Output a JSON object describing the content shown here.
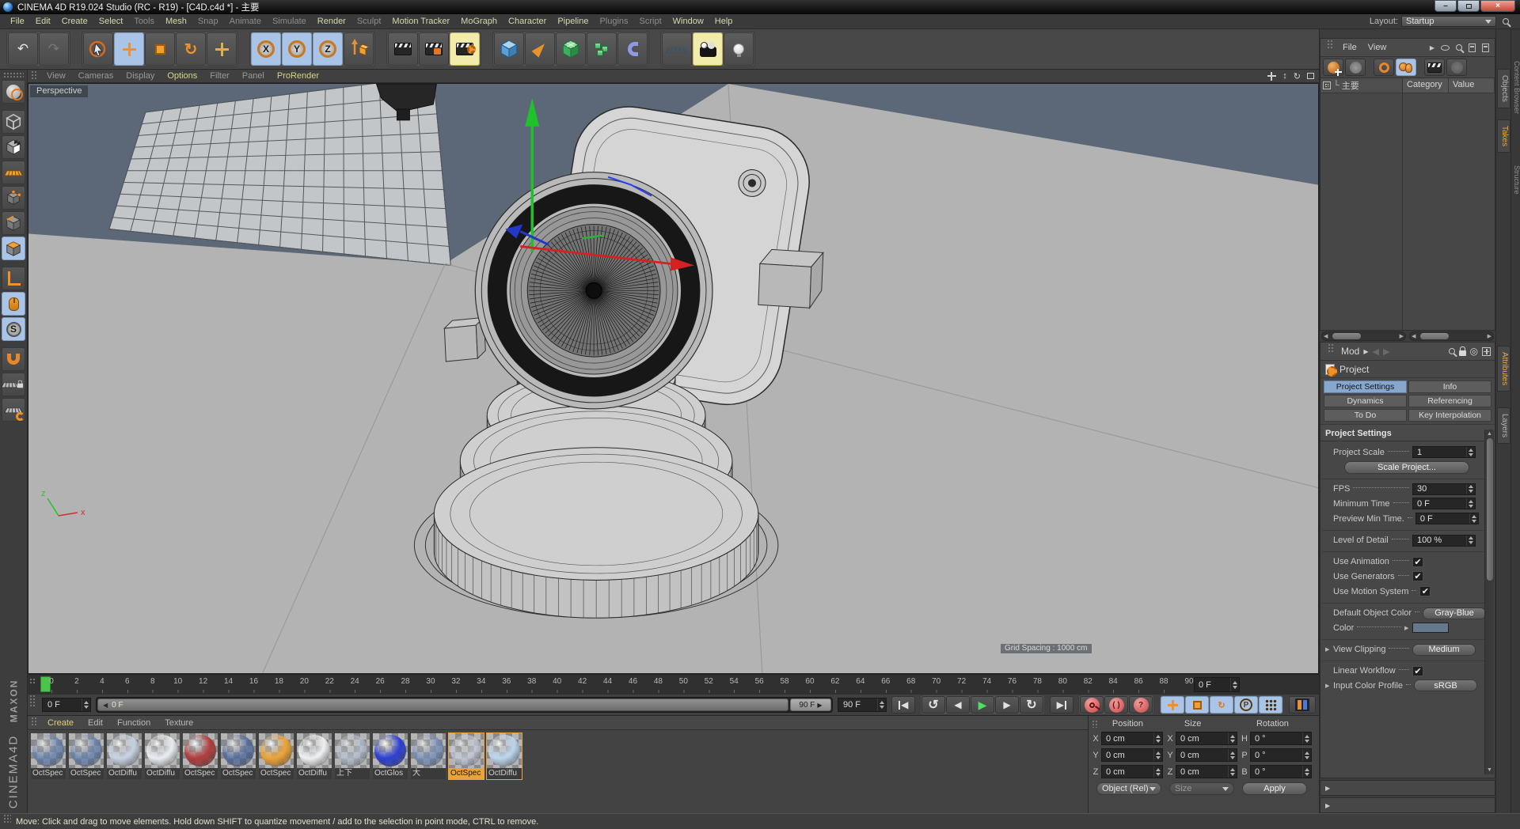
{
  "window": {
    "title": "CINEMA 4D R19.024 Studio (RC - R19) - [C4D.c4d *] - 主要"
  },
  "menu": {
    "items": [
      {
        "label": "File",
        "dim": false
      },
      {
        "label": "Edit",
        "dim": false
      },
      {
        "label": "Create",
        "dim": false
      },
      {
        "label": "Select",
        "dim": false
      },
      {
        "label": "Tools",
        "dim": true
      },
      {
        "label": "Mesh",
        "dim": false
      },
      {
        "label": "Snap",
        "dim": true
      },
      {
        "label": "Animate",
        "dim": true
      },
      {
        "label": "Simulate",
        "dim": true
      },
      {
        "label": "Render",
        "dim": false
      },
      {
        "label": "Sculpt",
        "dim": true
      },
      {
        "label": "Motion Tracker",
        "dim": false
      },
      {
        "label": "MoGraph",
        "dim": false
      },
      {
        "label": "Character",
        "dim": false
      },
      {
        "label": "Pipeline",
        "dim": false
      },
      {
        "label": "Plugins",
        "dim": true
      },
      {
        "label": "Script",
        "dim": true
      },
      {
        "label": "Window",
        "dim": false
      },
      {
        "label": "Help",
        "dim": false
      }
    ],
    "layout_label": "Layout:",
    "layout_value": "Startup"
  },
  "toolbar": {
    "axis": [
      "X",
      "Y",
      "Z"
    ]
  },
  "viewport": {
    "menu": [
      {
        "label": "View",
        "lit": false
      },
      {
        "label": "Cameras",
        "lit": false
      },
      {
        "label": "Display",
        "lit": false
      },
      {
        "label": "Options",
        "lit": true
      },
      {
        "label": "Filter",
        "lit": false
      },
      {
        "label": "Panel",
        "lit": false
      },
      {
        "label": "ProRender",
        "lit": true
      }
    ],
    "camera_label": "Perspective",
    "grid_spacing": "Grid Spacing : 1000 cm",
    "axis_z": "z",
    "axis_x": "x"
  },
  "timeline": {
    "start": 0,
    "end": 90,
    "label_step": 2,
    "ruler_field": "0 F",
    "current": "0 F",
    "scrub_left": "0 F",
    "scrub_right": "90 F",
    "end_field": "90 F"
  },
  "materials": {
    "menus": [
      {
        "label": "Create",
        "lit": true
      },
      {
        "label": "Edit",
        "lit": false
      },
      {
        "label": "Function",
        "lit": false
      },
      {
        "label": "Texture",
        "lit": false
      }
    ],
    "items": [
      {
        "label": "OctSpec",
        "color": "#5c7cb2",
        "glass": true
      },
      {
        "label": "OctSpec",
        "color": "#5c7cb2",
        "glass": true
      },
      {
        "label": "OctDiffu",
        "color": "#c7d2e4"
      },
      {
        "label": "OctDiffu",
        "color": "#e9edf2"
      },
      {
        "label": "OctSpec",
        "color": "#b23c3c"
      },
      {
        "label": "OctSpec",
        "color": "#41609f",
        "glass": true
      },
      {
        "label": "OctSpec",
        "color": "#eda335"
      },
      {
        "label": "OctDiffu",
        "color": "#eef0f2"
      },
      {
        "label": "上下",
        "color": "#b6c4d6",
        "glass": true
      },
      {
        "label": "OctGlos",
        "color": "#2b3fd6"
      },
      {
        "label": "大",
        "color": "#6e8cc0",
        "glass": true
      },
      {
        "label": "OctSpec",
        "color": "#c9cfe2",
        "glass": true,
        "selected": true
      },
      {
        "label": "OctDiffu",
        "color": "#bcd6ee",
        "outlined": true
      }
    ]
  },
  "coordinates": {
    "headers": [
      "Position",
      "Size",
      "Rotation"
    ],
    "rows": [
      {
        "cells": [
          {
            "axis": "X",
            "value": "0 cm"
          },
          {
            "axis": "X",
            "value": "0 cm"
          },
          {
            "axis": "H",
            "value": "0 °"
          }
        ]
      },
      {
        "cells": [
          {
            "axis": "Y",
            "value": "0 cm"
          },
          {
            "axis": "Y",
            "value": "0 cm"
          },
          {
            "axis": "P",
            "value": "0 °"
          }
        ]
      },
      {
        "cells": [
          {
            "axis": "Z",
            "value": "0 cm"
          },
          {
            "axis": "Z",
            "value": "0 cm"
          },
          {
            "axis": "B",
            "value": "0 °"
          }
        ]
      }
    ],
    "object_mode": "Object (Rel)",
    "size_mode": "Size",
    "apply": "Apply"
  },
  "takes_panel": {
    "menus": [
      "File",
      "View"
    ],
    "tree_item": "主要",
    "columns": [
      "Category",
      "Value"
    ],
    "side_tabs": [
      {
        "label": "Objects",
        "active": false
      },
      {
        "label": "Takes",
        "active": true
      }
    ]
  },
  "attributes_panel": {
    "mode_label": "Mod",
    "object_label": "Project",
    "tabs": [
      "Project Settings",
      "Info",
      "Dynamics",
      "Referencing",
      "To Do",
      "Key Interpolation"
    ],
    "active_tab": "Project Settings",
    "section_title": "Project Settings",
    "fields": [
      {
        "label": "Project Scale",
        "value": "1",
        "type": "stepper"
      },
      {
        "label": "",
        "value": "Scale Project...",
        "type": "wideButton"
      },
      {
        "label": "FPS",
        "value": "30",
        "type": "stepper",
        "group_start": true
      },
      {
        "label": "Minimum Time",
        "value": "0 F",
        "type": "stepper"
      },
      {
        "label": "Preview Min Time.",
        "value": "0 F",
        "type": "stepper"
      },
      {
        "label": "Level of Detail",
        "value": "100 %",
        "type": "stepper",
        "group_start": true
      },
      {
        "label": "Use Animation",
        "type": "check",
        "checked": true,
        "group_start": true
      },
      {
        "label": "Use Generators",
        "type": "check",
        "checked": true
      },
      {
        "label": "Use Motion System",
        "type": "check",
        "checked": true
      },
      {
        "label": "Default Object Color",
        "value": "Gray-Blue",
        "type": "button",
        "group_start": true
      },
      {
        "label": "Color",
        "type": "swatch",
        "swatch": "#67788c",
        "mid_arrow": true
      },
      {
        "label": "View Clipping",
        "value": "Medium",
        "type": "button",
        "pre_arrow": true,
        "group_start": true
      },
      {
        "label": "Linear Workflow",
        "type": "check",
        "checked": true,
        "group_start": true
      },
      {
        "label": "Input Color Profile",
        "value": "sRGB",
        "type": "button",
        "pre_arrow": true
      }
    ],
    "side_tabs": [
      {
        "label": "Attributes",
        "active": true
      },
      {
        "label": "Layers",
        "active": false
      }
    ]
  },
  "edge_tabs": [
    "Content Browser",
    "Structure"
  ],
  "status_bar": "Move: Click and drag to move elements. Hold down SHIFT to quantize movement / add to the selection in point mode, CTRL to remove.",
  "branding": {
    "maxon": "MAXON",
    "cinema": "CINEMA4D"
  },
  "icons": {
    "undo": "↶",
    "redo": "↷",
    "min": "–",
    "close": "×",
    "arrow_l": "◀",
    "arrow_r": "▶",
    "arrow_u": "▲",
    "arrow_d": "▼",
    "play": "▶",
    "prev_key": "↺",
    "next_key": "↻",
    "rotate": "↻",
    "updown": "↕",
    "question": "?",
    "parens": "( )",
    "target": "◎",
    "check": "✔",
    "p": "P",
    "s": "S",
    "branch": "└",
    "expand": "▶"
  }
}
